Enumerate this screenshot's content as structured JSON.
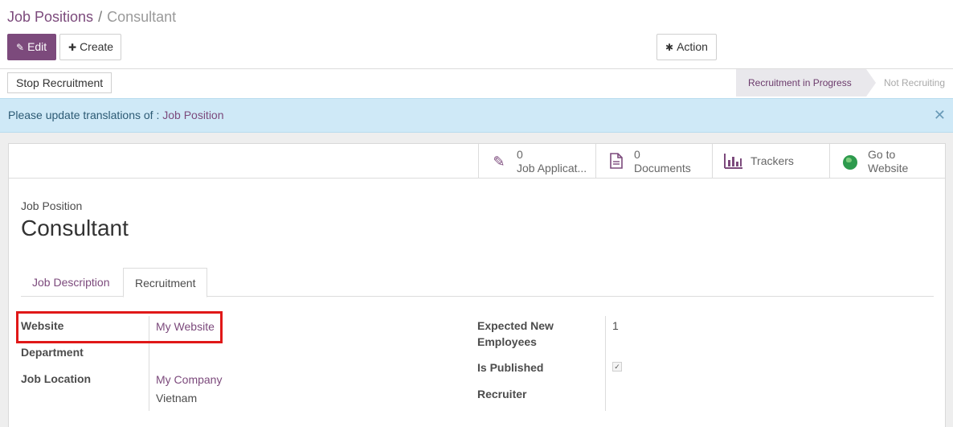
{
  "breadcrumb": {
    "root": "Job Positions",
    "separator": "/",
    "current": "Consultant"
  },
  "toolbar": {
    "edit_label": "Edit",
    "create_label": "Create",
    "action_label": "Action"
  },
  "statusbar": {
    "stop_label": "Stop Recruitment",
    "stage_active": "Recruitment in Progress",
    "stage_next": "Not Recruiting"
  },
  "notice": {
    "text": "Please update translations of :",
    "link": "Job Position",
    "close": "✕"
  },
  "smart_buttons": [
    {
      "count": "0",
      "label": "Job Applicat...",
      "icon": "pencil-icon"
    },
    {
      "count": "0",
      "label": "Documents",
      "icon": "document-icon"
    },
    {
      "label": "Trackers",
      "icon": "bar-chart-icon"
    },
    {
      "label1": "Go to",
      "label2": "Website",
      "icon": "globe-icon"
    }
  ],
  "form": {
    "small_label": "Job Position",
    "title": "Consultant",
    "tabs": [
      "Job Description",
      "Recruitment"
    ],
    "left_fields": [
      {
        "label": "Website",
        "value": "My Website"
      },
      {
        "label": "Department",
        "value": ""
      },
      {
        "label": "Job Location",
        "value": "My Company",
        "value2": "Vietnam"
      }
    ],
    "right_fields": [
      {
        "label": "Expected New",
        "label2": "Employees",
        "value": "1"
      },
      {
        "label": "Is Published",
        "value": "✓"
      },
      {
        "label": "Recruiter",
        "value": ""
      }
    ]
  },
  "colors": {
    "brand": "#7c4a7c",
    "notice_bg": "#cfe9f7",
    "highlight": "#e01818"
  }
}
